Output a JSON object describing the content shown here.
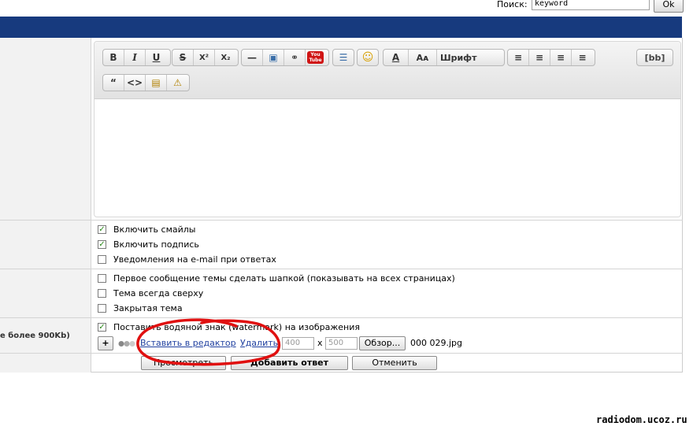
{
  "search": {
    "label": "Поиск:",
    "value": "keyword",
    "button": "Ok"
  },
  "toolbar": {
    "row1": [
      [
        "B",
        "I",
        "U"
      ],
      [
        "S",
        "X²",
        "X₂"
      ],
      [
        "—",
        "▣",
        "⚭",
        "You Tube"
      ],
      [
        "☰"
      ],
      [
        "☺"
      ],
      [
        "A",
        "Aᴀ",
        "Шрифт"
      ],
      [
        "≡",
        "≡",
        "≡",
        "≡"
      ]
    ],
    "bb": "[bb]",
    "row2": [
      "“",
      "<>",
      "▤",
      "⚠"
    ]
  },
  "options": {
    "smiles": "Включить смайлы",
    "signature": "Включить подпись",
    "email_notify": "Уведомления на e-mail при ответах",
    "pin_first": "Первое сообщение темы сделать шапкой (показывать на всех страницах)",
    "sticky": "Тема всегда сверху",
    "closed": "Закрытая тема",
    "watermark": "Поставить водяной знак (watermark) на изображения"
  },
  "upload": {
    "left_label": "е более 900Kb)",
    "add": "+",
    "insert_link": "Вставить в редактор",
    "delete_link": "Удалить",
    "width": "400",
    "x": "x",
    "height": "500",
    "browse": "Обзор...",
    "filename": "000 029.jpg"
  },
  "buttons": {
    "preview": "Просмотреть",
    "submit": "Добавить ответ",
    "cancel": "Отменить"
  },
  "watermark_text": "radiodom.ucoz.ru",
  "colors": {
    "header": "#173a7e",
    "check": "#2a8a1a",
    "annotation": "#e01010"
  }
}
